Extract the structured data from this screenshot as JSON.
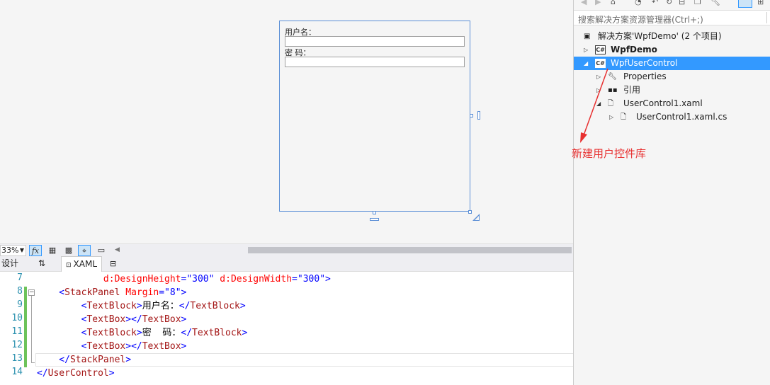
{
  "designer": {
    "label_username": "用户名：",
    "label_password": "密 码："
  },
  "toolbar": {
    "zoom": "33%",
    "fx_label": "fx"
  },
  "split_tabs": {
    "design": "设计",
    "swap": "⇅",
    "xaml": "XAML"
  },
  "editor": {
    "line_numbers": [
      "7",
      "8",
      "9",
      "10",
      "11",
      "12",
      "13",
      "14"
    ],
    "lines": [
      [
        [
          "attr",
          "            d:DesignHeight"
        ],
        [
          "delim",
          "=\""
        ],
        [
          "val",
          "300"
        ],
        [
          "delim",
          "\""
        ],
        [
          "attr",
          " d:DesignWidth"
        ],
        [
          "delim",
          "=\""
        ],
        [
          "val",
          "300"
        ],
        [
          "delim",
          "\">"
        ]
      ],
      [
        [
          "delim",
          "    <"
        ],
        [
          "tag",
          "StackPanel"
        ],
        [
          "attr",
          " Margin"
        ],
        [
          "delim",
          "=\""
        ],
        [
          "val",
          "8"
        ],
        [
          "delim",
          "\">"
        ]
      ],
      [
        [
          "delim",
          "        <"
        ],
        [
          "tag",
          "TextBlock"
        ],
        [
          "delim",
          ">"
        ],
        [
          "text",
          "用户名："
        ],
        [
          "delim",
          "</"
        ],
        [
          "tag",
          "TextBlock"
        ],
        [
          "delim",
          ">"
        ]
      ],
      [
        [
          "delim",
          "        <"
        ],
        [
          "tag",
          "TextBox"
        ],
        [
          "delim",
          "></"
        ],
        [
          "tag",
          "TextBox"
        ],
        [
          "delim",
          ">"
        ]
      ],
      [
        [
          "delim",
          "        <"
        ],
        [
          "tag",
          "TextBlock"
        ],
        [
          "delim",
          ">"
        ],
        [
          "text",
          "密  码："
        ],
        [
          "delim",
          "</"
        ],
        [
          "tag",
          "TextBlock"
        ],
        [
          "delim",
          ">"
        ]
      ],
      [
        [
          "delim",
          "        <"
        ],
        [
          "tag",
          "TextBox"
        ],
        [
          "delim",
          "></"
        ],
        [
          "tag",
          "TextBox"
        ],
        [
          "delim",
          ">"
        ]
      ],
      [
        [
          "delim",
          "    </"
        ],
        [
          "tag",
          "StackPanel"
        ],
        [
          "delim",
          ">"
        ]
      ],
      [
        [
          "delim",
          "</"
        ],
        [
          "tag",
          "UserControl"
        ],
        [
          "delim",
          ">"
        ]
      ]
    ]
  },
  "solution_explorer": {
    "search_placeholder": "搜索解决方案资源管理器(Ctrl+;)",
    "tree": [
      {
        "label": "解决方案'WpfDemo' (2 个项目)",
        "bold": false,
        "selected": false,
        "expander": "",
        "icon": "solution-icon"
      },
      {
        "label": "WpfDemo",
        "bold": true,
        "selected": false,
        "expander": "▷",
        "icon": "csharp-project-icon"
      },
      {
        "label": "WpfUserControl",
        "bold": false,
        "selected": true,
        "expander": "◢",
        "icon": "csharp-project-icon"
      },
      {
        "label": "Properties",
        "bold": false,
        "selected": false,
        "expander": "▷",
        "icon": "wrench-icon"
      },
      {
        "label": "引用",
        "bold": false,
        "selected": false,
        "expander": "▷",
        "icon": "references-icon"
      },
      {
        "label": "UserControl1.xaml",
        "bold": false,
        "selected": false,
        "expander": "◢",
        "icon": "xaml-file-icon"
      },
      {
        "label": "UserControl1.xaml.cs",
        "bold": false,
        "selected": false,
        "expander": "▷",
        "icon": "cs-file-icon"
      }
    ]
  },
  "annotation": {
    "text": "新建用户控件库",
    "color": "#e83030"
  },
  "colors": {
    "selection": "#3399ff",
    "designer_border": "#5b8fd6",
    "change_bar": "#6dc35a"
  }
}
